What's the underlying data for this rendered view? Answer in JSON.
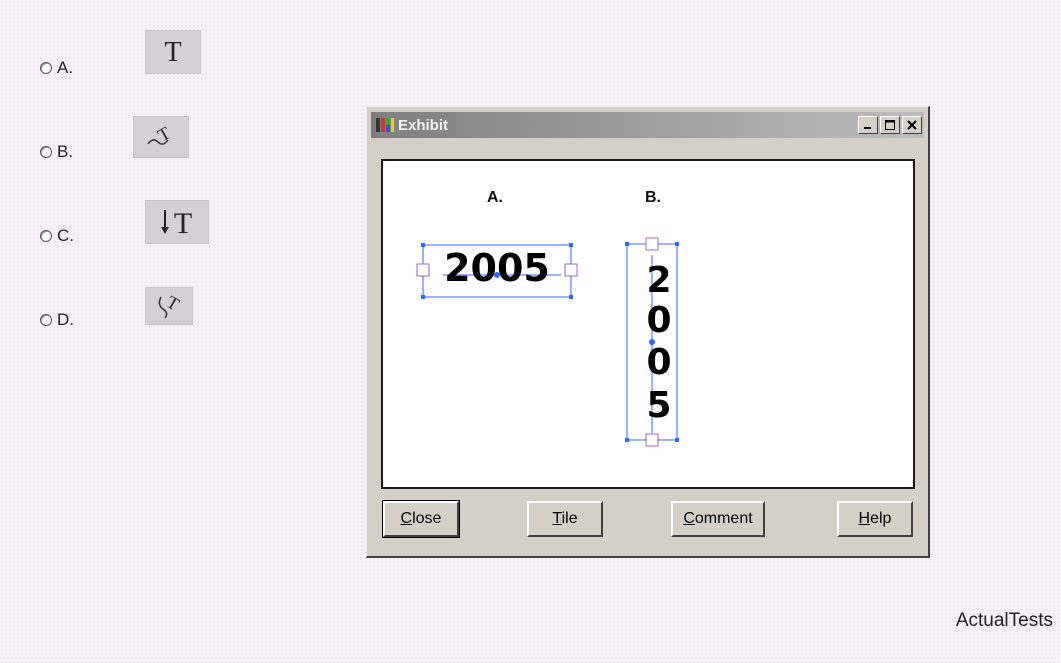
{
  "options": [
    {
      "label": "A.",
      "icon": "type-tool-icon"
    },
    {
      "label": "B.",
      "icon": "path-type-tool-icon"
    },
    {
      "label": "C.",
      "icon": "vertical-type-tool-icon"
    },
    {
      "label": "D.",
      "icon": "vertical-path-type-tool-icon"
    }
  ],
  "exhibit": {
    "title": "Exhibit",
    "label_a": "A.",
    "label_b": "B.",
    "text_a": "2005",
    "text_b": [
      "2",
      "0",
      "0",
      "5"
    ],
    "buttons": {
      "close": "Close",
      "tile": "Tile",
      "comment": "Comment",
      "help": "Help"
    }
  },
  "colors": {
    "selection": "#3366ff",
    "handle": "#9966cc"
  },
  "footer": "ActualTests"
}
